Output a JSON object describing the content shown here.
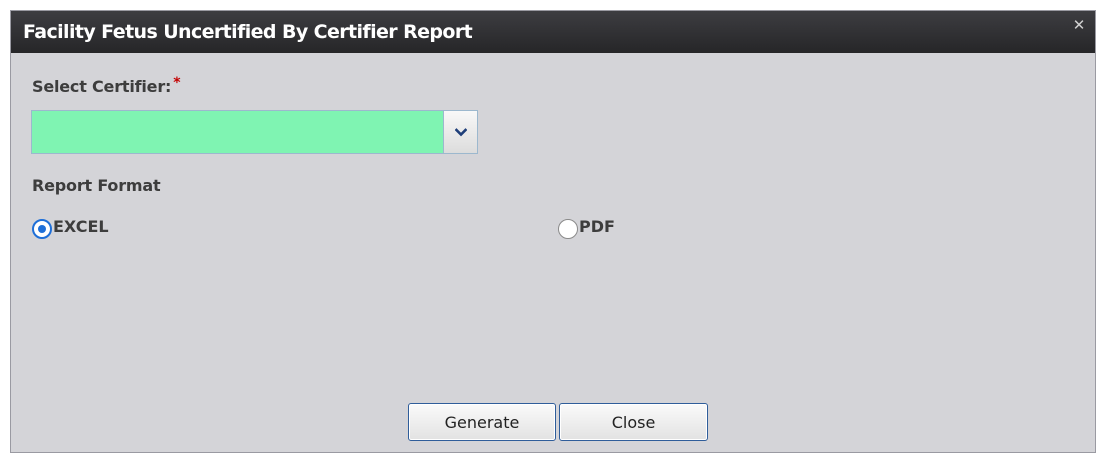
{
  "dialog": {
    "title": "Facility Fetus Uncertified By Certifier Report",
    "close_symbol": "✕"
  },
  "certifier": {
    "label": "Select Certifier:",
    "required_marker": "*",
    "value": "",
    "field_color": "#7ff4b2"
  },
  "report_format": {
    "label": "Report Format",
    "options": [
      {
        "label": "EXCEL",
        "selected": true
      },
      {
        "label": "PDF",
        "selected": false
      }
    ]
  },
  "buttons": {
    "generate_label": "Generate",
    "close_label": "Close"
  },
  "colors": {
    "titlebar": "#2f2f32",
    "background": "#d4d4d8",
    "radio_accent": "#1e6fd8",
    "button_border": "#2f5d9a"
  },
  "icons": {
    "close": "close-icon",
    "dropdown": "chevron-down-icon"
  }
}
